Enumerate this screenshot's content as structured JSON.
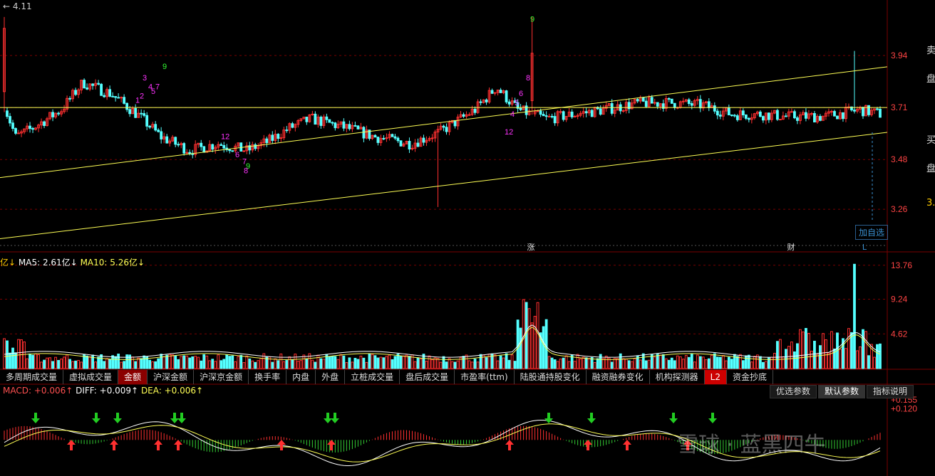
{
  "price_panel": {
    "high_label": "4.11",
    "y_ticks": [
      3.94,
      3.71,
      3.48,
      3.26
    ],
    "add_watch_label": "加自选",
    "event_markers": [
      "涨",
      "财",
      "L"
    ]
  },
  "volume_panel": {
    "ma5_label": "MA5: 2.61亿↓",
    "ma10_label": "MA10: 5.26亿↓",
    "prefix": "亿↓",
    "y_ticks": [
      13.76,
      9.24,
      4.62
    ]
  },
  "tabs": [
    "多周期成交量",
    "虚拟成交量",
    "金额",
    "沪深金额",
    "沪深京金额",
    "换手率",
    "内盘",
    "外盘",
    "立桩成交量",
    "盘后成交量",
    "市盈率(ttm)",
    "陆股通持股变化",
    "融资融券变化",
    "机构探测器",
    "L2",
    "资金抄底"
  ],
  "active_tab": "金额",
  "param_buttons": [
    "优选参数",
    "默认参数",
    "指标说明"
  ],
  "macd_panel": {
    "macd_label": "MACD: +0.006↑",
    "diff_label": "DIFF: +0.009↑",
    "dea_label": "DEA: +0.006↑",
    "y_ticks": [
      "+0.155",
      "+0.120"
    ]
  },
  "side_text": [
    "卖",
    "盘",
    "买",
    "盘",
    "3."
  ],
  "watermark": "雪球 · 蓝黑四牛",
  "colors": {
    "up": "#ff3030",
    "down": "#54ffff",
    "ma_yellow": "#ffff55",
    "ma_white": "#ffffff",
    "grid": "#7a0000"
  },
  "chart_data": {
    "type": "candlestick",
    "price_range": [
      3.1,
      4.16
    ],
    "volume_range": [
      0,
      14.5
    ],
    "macd_range": [
      -0.12,
      0.16
    ],
    "td_counts_visible": [
      "1",
      "2",
      "3",
      "4",
      "5",
      "6",
      "7",
      "8",
      "9",
      "12"
    ]
  }
}
